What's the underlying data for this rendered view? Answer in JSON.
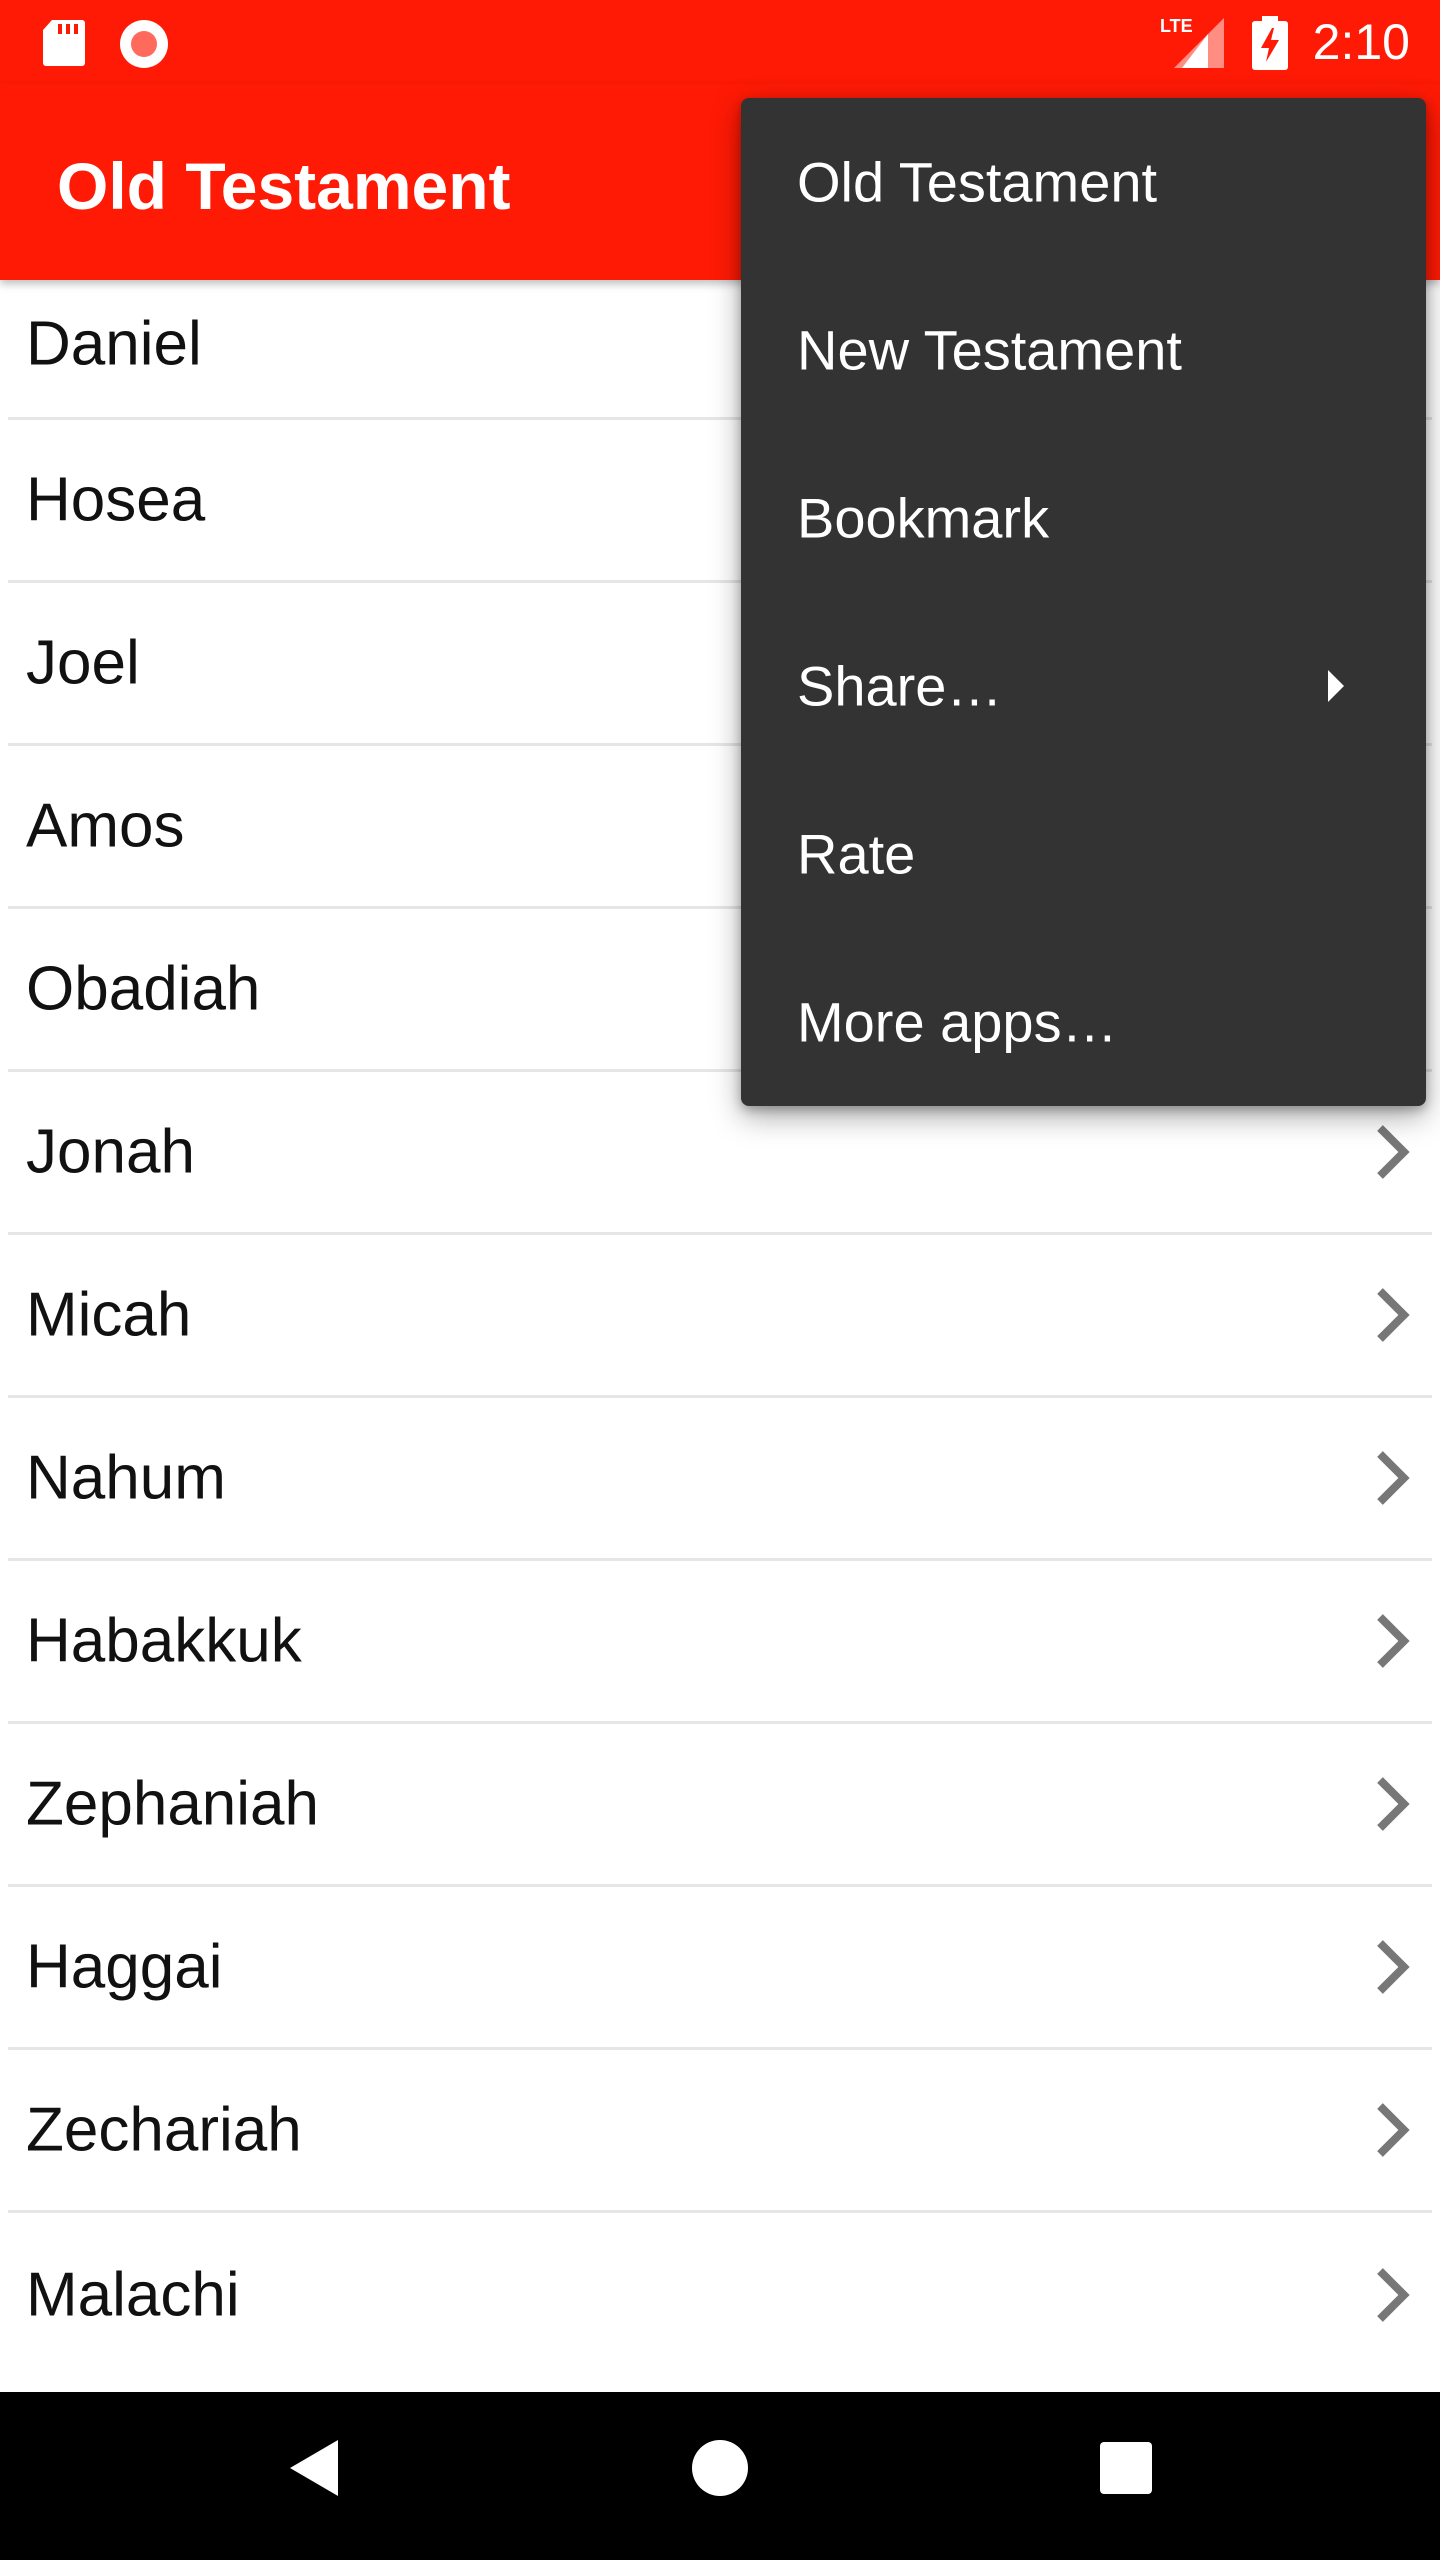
{
  "status_bar": {
    "time": "2:10",
    "network_label": "LTE",
    "icons": [
      "sd-card-icon",
      "record-icon",
      "lte-signal-icon",
      "battery-charging-icon"
    ]
  },
  "app_bar": {
    "title": "Old Testament",
    "background_color": "#ff1a05"
  },
  "books": [
    {
      "label": "Daniel"
    },
    {
      "label": "Hosea"
    },
    {
      "label": "Joel"
    },
    {
      "label": "Amos"
    },
    {
      "label": "Obadiah"
    },
    {
      "label": "Jonah"
    },
    {
      "label": "Micah"
    },
    {
      "label": "Nahum"
    },
    {
      "label": "Habakkuk"
    },
    {
      "label": "Zephaniah"
    },
    {
      "label": "Haggai"
    },
    {
      "label": "Zechariah"
    },
    {
      "label": "Malachi"
    }
  ],
  "overflow_menu": {
    "background_color": "#333333",
    "items": [
      {
        "label": "Old Testament"
      },
      {
        "label": "New Testament"
      },
      {
        "label": "Bookmark"
      },
      {
        "label": "Share…",
        "has_submenu": true
      },
      {
        "label": "Rate"
      },
      {
        "label": "More apps…"
      }
    ]
  },
  "nav_bar": {
    "icons": [
      "back-icon",
      "home-icon",
      "recents-icon"
    ]
  }
}
